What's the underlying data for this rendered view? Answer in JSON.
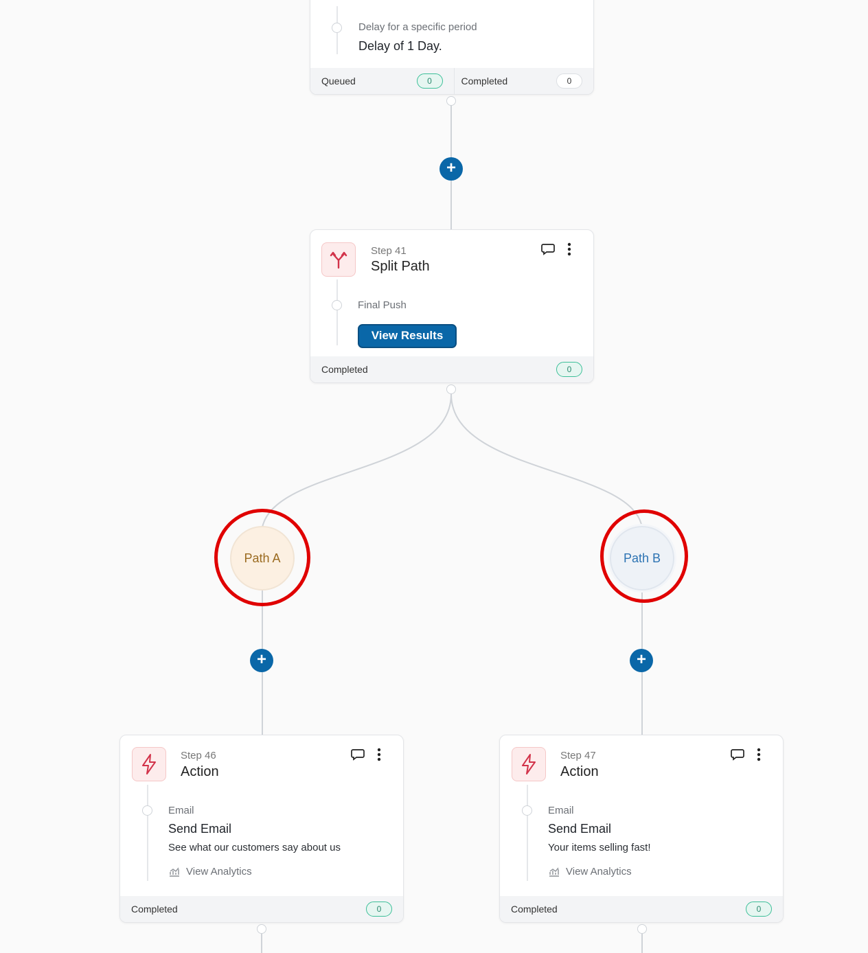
{
  "delay_card": {
    "subtitle": "Delay for a specific period",
    "title": "Delay of 1 Day.",
    "queued_label": "Queued",
    "queued_count": "0",
    "completed_label": "Completed",
    "completed_count": "0"
  },
  "split_card": {
    "step": "Step 41",
    "title": "Split Path",
    "detail": "Final Push",
    "button": "View Results",
    "completed_label": "Completed",
    "completed_count": "0"
  },
  "paths": {
    "a": "Path A",
    "b": "Path B"
  },
  "action_cards": [
    {
      "step": "Step 46",
      "title": "Action",
      "type": "Email",
      "action": "Send Email",
      "subject": "See what our customers say about us",
      "analytics": "View Analytics",
      "completed_label": "Completed",
      "completed_count": "0"
    },
    {
      "step": "Step 47",
      "title": "Action",
      "type": "Email",
      "action": "Send Email",
      "subject": "Your items selling fast!",
      "analytics": "View Analytics",
      "completed_label": "Completed",
      "completed_count": "0"
    }
  ],
  "add_button": "+",
  "colors": {
    "accent": "#0a67a8",
    "highlight": "#e00000",
    "success": "#3cbf98"
  }
}
